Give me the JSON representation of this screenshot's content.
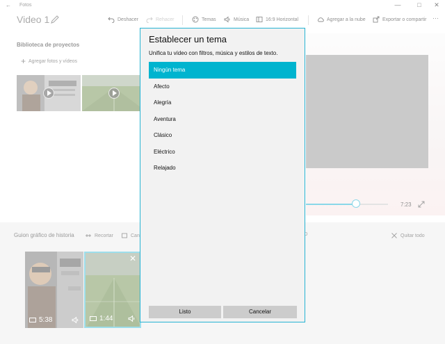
{
  "window": {
    "back_glyph": "←",
    "title": "Fotos",
    "minimize": "—",
    "maximize": "□",
    "close": "✕"
  },
  "toolbar": {
    "project_name": "Video 1",
    "undo": "Deshacer",
    "redo": "Rehacer",
    "themes": "Temas",
    "music": "Música",
    "aspect": "16:9 Horizontal",
    "cloud": "Agregar a la nube",
    "export": "Exportar o compartir",
    "more": "···"
  },
  "library": {
    "title": "Biblioteca de proyectos",
    "add_label": "Agregar fotos y vídeos"
  },
  "preview": {
    "duration": "7:23",
    "progress": 0.61
  },
  "storyboard": {
    "title": "Guion gráfico de historia",
    "trim": "Recortar",
    "resize_partial": "Can",
    "threed_partial": "s 3D",
    "remove_all": "Quitar todo",
    "clips": [
      {
        "duration": "5:38"
      },
      {
        "duration": "1:44"
      }
    ],
    "close_glyph": "✕"
  },
  "dialog": {
    "title": "Establecer un tema",
    "subtitle": "Unifica tu vídeo con filtros, música y estilos de texto.",
    "themes": [
      "Ningún tema",
      "Afecto",
      "Alegría",
      "Aventura",
      "Clásico",
      "Eléctrico",
      "Relajado"
    ],
    "selected_index": 0,
    "ok": "Listo",
    "cancel": "Cancelar"
  },
  "colors": {
    "accent": "#00b4cf",
    "dialog_border": "#25b3d3",
    "preview": "#9e9e9e"
  }
}
